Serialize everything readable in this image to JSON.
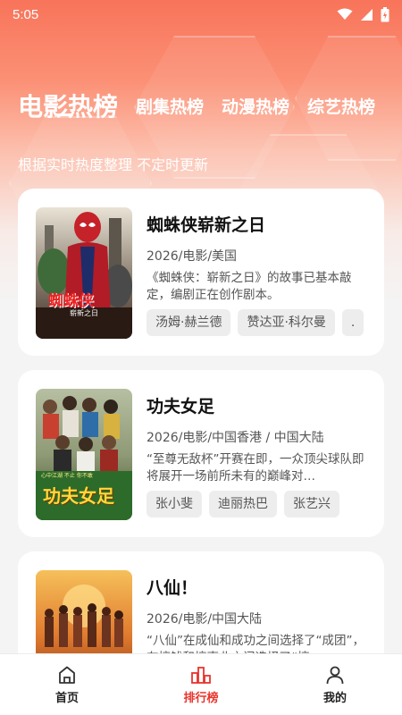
{
  "status": {
    "time": "5:05"
  },
  "tabs": [
    {
      "label": "电影热榜",
      "active": true
    },
    {
      "label": "剧集热榜",
      "active": false
    },
    {
      "label": "动漫热榜",
      "active": false
    },
    {
      "label": "综艺热榜",
      "active": false
    }
  ],
  "subtitle": "根据实时热度整理 不定时更新",
  "cards": [
    {
      "title": "蜘蛛侠崭新之日",
      "meta": "2026/电影/美国",
      "description": "《蜘蛛侠：崭新之日》的故事已基本敲定，编剧正在创作剧本。",
      "tags": [
        "汤姆·赫兰德",
        "赞达亚·科尔曼",
        "."
      ],
      "poster_text": "蜘蛛侠",
      "poster_subtext": "崭新之日"
    },
    {
      "title": "功夫女足",
      "meta": "2026/电影/中国香港 / 中国大陆",
      "description": "“至尊无敌杯”开赛在即，一众顶尖球队即将展开一场前所未有的巅峰对…",
      "tags": [
        "张小斐",
        "迪丽热巴",
        "张艺兴"
      ],
      "poster_text": "功夫女足",
      "poster_subtext": "心中江湖 不止 你不敢"
    },
    {
      "title": "八仙！",
      "meta": "2026/电影/中国大陆",
      "description": "“八仙”在成仙和成功之间选择了“成团”，在搞钱和搞事业之间选择了“搞",
      "tags": [],
      "poster_text": "",
      "poster_subtext": ""
    }
  ],
  "bottom_nav": [
    {
      "label": "首页",
      "icon": "home-icon",
      "active": false
    },
    {
      "label": "排行榜",
      "icon": "ranking-icon",
      "active": true
    },
    {
      "label": "我的",
      "icon": "profile-icon",
      "active": false
    }
  ],
  "colors": {
    "accent": "#e8342c",
    "header_top": "#f8745a",
    "background": "#f4f4f4"
  }
}
